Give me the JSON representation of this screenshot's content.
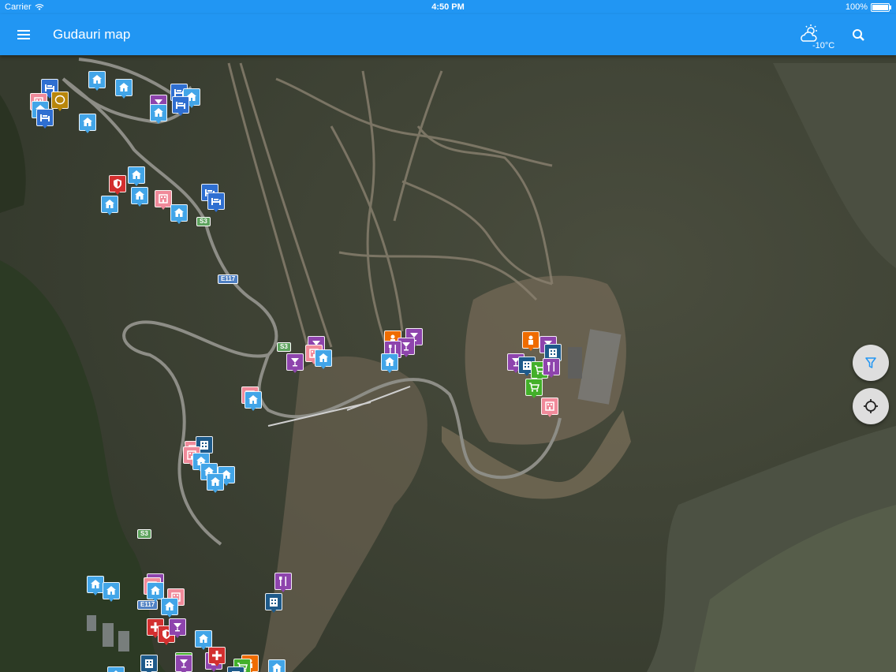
{
  "status_bar": {
    "carrier": "Carrier",
    "time": "4:50 PM",
    "battery": "100%"
  },
  "app_bar": {
    "title": "Gudauri map",
    "temperature": "-10°C"
  },
  "icons": {
    "menu": "menu-icon",
    "weather": "partly-cloudy-icon",
    "search": "search-icon",
    "filter": "filter-icon",
    "locate": "crosshair-icon"
  },
  "road_labels": [
    {
      "text": "S3",
      "type": "national"
    },
    {
      "text": "E117",
      "type": "european"
    },
    {
      "text": "S3",
      "type": "national"
    },
    {
      "text": "S3",
      "type": "national"
    },
    {
      "text": "E117",
      "type": "european"
    }
  ],
  "marker_categories": {
    "lodging": {
      "color": "#42a5e8",
      "icon": "house-icon"
    },
    "hostel": {
      "color": "#2f6fd1",
      "icon": "bed-icon"
    },
    "apartment": {
      "color": "#f08a9a",
      "icon": "apartment-icon"
    },
    "nightlife": {
      "color": "#8e44ad",
      "icon": "cocktail-icon"
    },
    "restaurant": {
      "color": "#8e44ad",
      "icon": "cutlery-icon"
    },
    "police": {
      "color": "#d32f2f",
      "icon": "shield-icon"
    },
    "medical": {
      "color": "#d32f2f",
      "icon": "cross-icon"
    },
    "shop": {
      "color": "#43b02a",
      "icon": "cart-icon"
    },
    "service": {
      "color": "#ef6c00",
      "icon": "service-icon"
    },
    "hotel": {
      "color": "#1e5a8a",
      "icon": "building-icon"
    },
    "landmark": {
      "color": "#b8860b",
      "icon": "place-icon"
    }
  }
}
